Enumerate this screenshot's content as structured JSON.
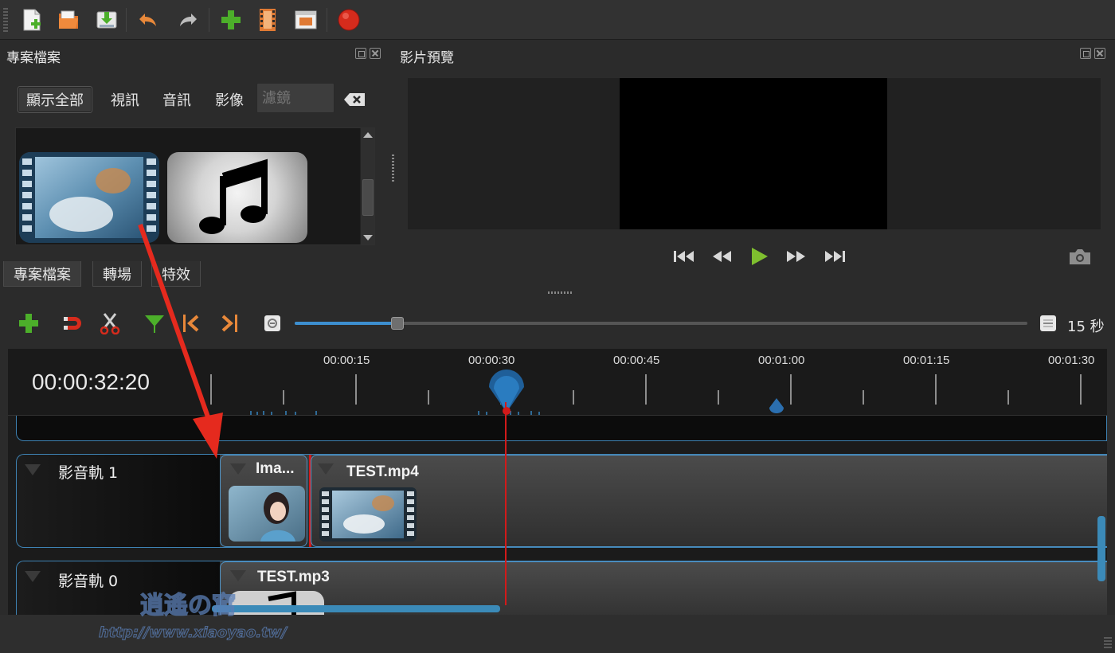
{
  "toolbar": {
    "buttons": [
      "new-project-icon",
      "open-project-icon",
      "save-project-icon",
      "undo-icon",
      "redo-icon",
      "import-files-icon",
      "profile-icon",
      "fullscreen-icon",
      "export-video-icon"
    ]
  },
  "project_files": {
    "title": "專案檔案",
    "filters": [
      "顯示全部",
      "視訊",
      "音訊",
      "影像"
    ],
    "filter_placeholder": "濾鏡",
    "tabs": [
      "專案檔案",
      "轉場",
      "特效"
    ]
  },
  "preview": {
    "title": "影片預覽"
  },
  "timeline_toolbar": {
    "zoom_label": "15 秒",
    "zoom_fraction": 0.14
  },
  "timeline": {
    "timecode": "00:00:32:20",
    "ruler_labels": [
      "00:00:15",
      "00:00:30",
      "00:00:45",
      "00:01:00",
      "00:01:15",
      "00:01:30"
    ],
    "tracks": [
      {
        "name": "影音軌 1",
        "clips": [
          "Ima...",
          "TEST.mp4"
        ]
      },
      {
        "name": "影音軌 0",
        "clips": [
          "TEST.mp3"
        ]
      }
    ]
  },
  "colors": {
    "accent": "#3e82b3",
    "playhead": "#d21a1a",
    "add": "#4caf2a",
    "record": "#d62b1c"
  },
  "watermark": "逍遙の窩 http://www.xiaoyao.tw/"
}
